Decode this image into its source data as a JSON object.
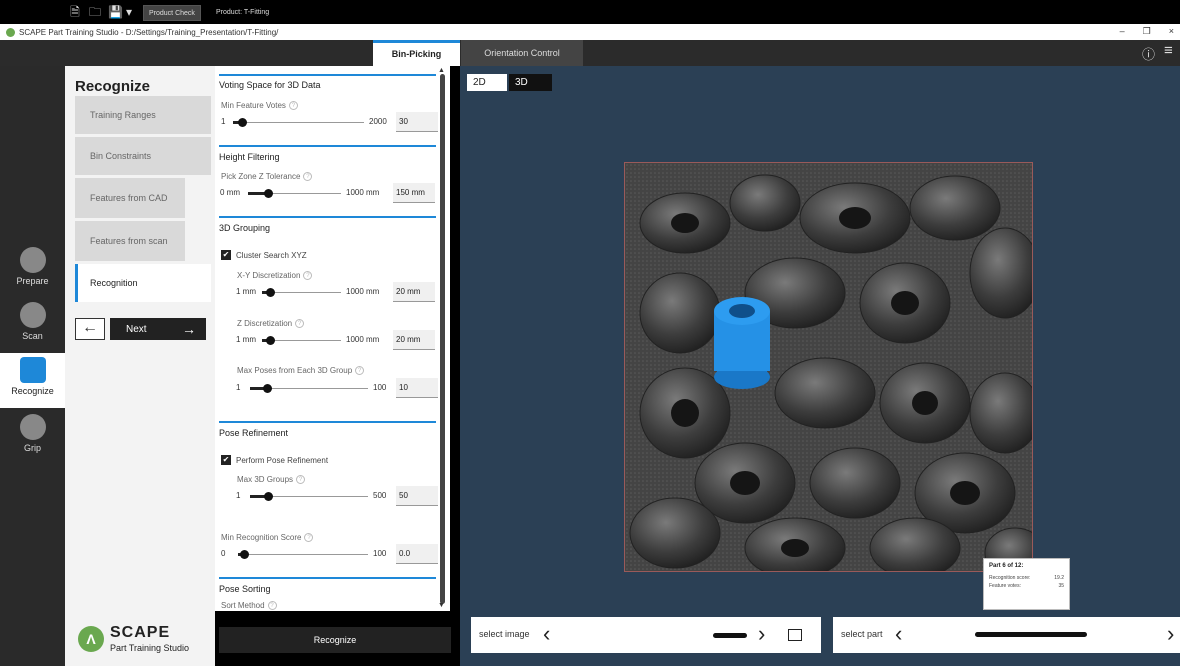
{
  "window": {
    "title": "SCAPE Part Training Studio - D:/Settings/Training_Presentation/T-Fitting/",
    "min_glyph": "–",
    "restore_glyph": "❐",
    "close_glyph": "×"
  },
  "toolbar": {
    "product_check": "Product Check",
    "product_name": "Product: T-Fitting",
    "new_glyph": "🗎",
    "open_glyph": "🗀",
    "save_glyph": "💾",
    "dropdown_glyph": "▾"
  },
  "tabs": [
    {
      "label": "Bin-Picking",
      "active": true
    },
    {
      "label": "Orientation Control",
      "active": false
    }
  ],
  "menu_right": {
    "info_glyph": "ⓘ",
    "menu_glyph": "≡"
  },
  "rail": [
    {
      "label": "Prepare",
      "active": false
    },
    {
      "label": "Scan",
      "active": false
    },
    {
      "label": "Recognize",
      "active": true
    },
    {
      "label": "Grip",
      "active": false
    }
  ],
  "section": {
    "title": "Recognize"
  },
  "steps": [
    {
      "label": "Training Ranges"
    },
    {
      "label": "Bin Constraints"
    },
    {
      "label": "Features from CAD"
    },
    {
      "label": "Features from scan"
    },
    {
      "label": "Recognition"
    }
  ],
  "nav": {
    "back_glyph": "←",
    "next_label": "Next",
    "next_glyph": "→"
  },
  "brand": {
    "logo_letter": "Λ",
    "name": "SCAPE",
    "sub": "Part Training Studio"
  },
  "params": {
    "help_glyph": "?",
    "check_glyph": "✔",
    "scroll_up": "▲",
    "scroll_down": "▼",
    "voting": {
      "title": "Voting Space for 3D Data",
      "min_feature_votes": {
        "label": "Min Feature Votes",
        "min": "1",
        "max": "2000",
        "value": "30",
        "fraction": 0.02
      }
    },
    "height": {
      "title": "Height Filtering",
      "pick_zone": {
        "label": "Pick Zone Z Tolerance",
        "min": "0 mm",
        "max": "1000 mm",
        "value": "150 mm",
        "fraction": 0.15
      }
    },
    "grouping": {
      "title": "3D Grouping",
      "cluster_search": "Cluster Search XYZ",
      "xy_disc": {
        "label": "X-Y Discretization",
        "min": "1 mm",
        "max": "1000 mm",
        "value": "20 mm",
        "fraction": 0.02
      },
      "z_disc": {
        "label": "Z Discretization",
        "min": "1 mm",
        "max": "1000 mm",
        "value": "20 mm",
        "fraction": 0.02
      },
      "max_poses": {
        "label": "Max Poses from Each 3D Group",
        "min": "1",
        "max": "100",
        "value": "10",
        "fraction": 0.09
      }
    },
    "refinement": {
      "title": "Pose Refinement",
      "perform": "Perform Pose Refinement",
      "max_groups": {
        "label": "Max 3D Groups",
        "min": "1",
        "max": "500",
        "value": "50",
        "fraction": 0.1
      },
      "min_score": {
        "label": "Min Recognition Score",
        "min": "0",
        "max": "100",
        "value": "0.0",
        "fraction": 0.0
      }
    },
    "sorting": {
      "title": "Pose Sorting",
      "sort_method": "Sort Method"
    }
  },
  "recognize_button": "Recognize",
  "viewer": {
    "view_2d": "2D",
    "view_3d": "3D",
    "tooltip": {
      "title": "Part 6 of 12:",
      "score_label": "Recognition score:",
      "score_value": "19.2",
      "votes_label": "Feature votes:",
      "votes_value": "35"
    }
  },
  "footer": {
    "select_image": "select image",
    "select_part": "select part",
    "left_chev": "‹",
    "right_chev": "›"
  }
}
